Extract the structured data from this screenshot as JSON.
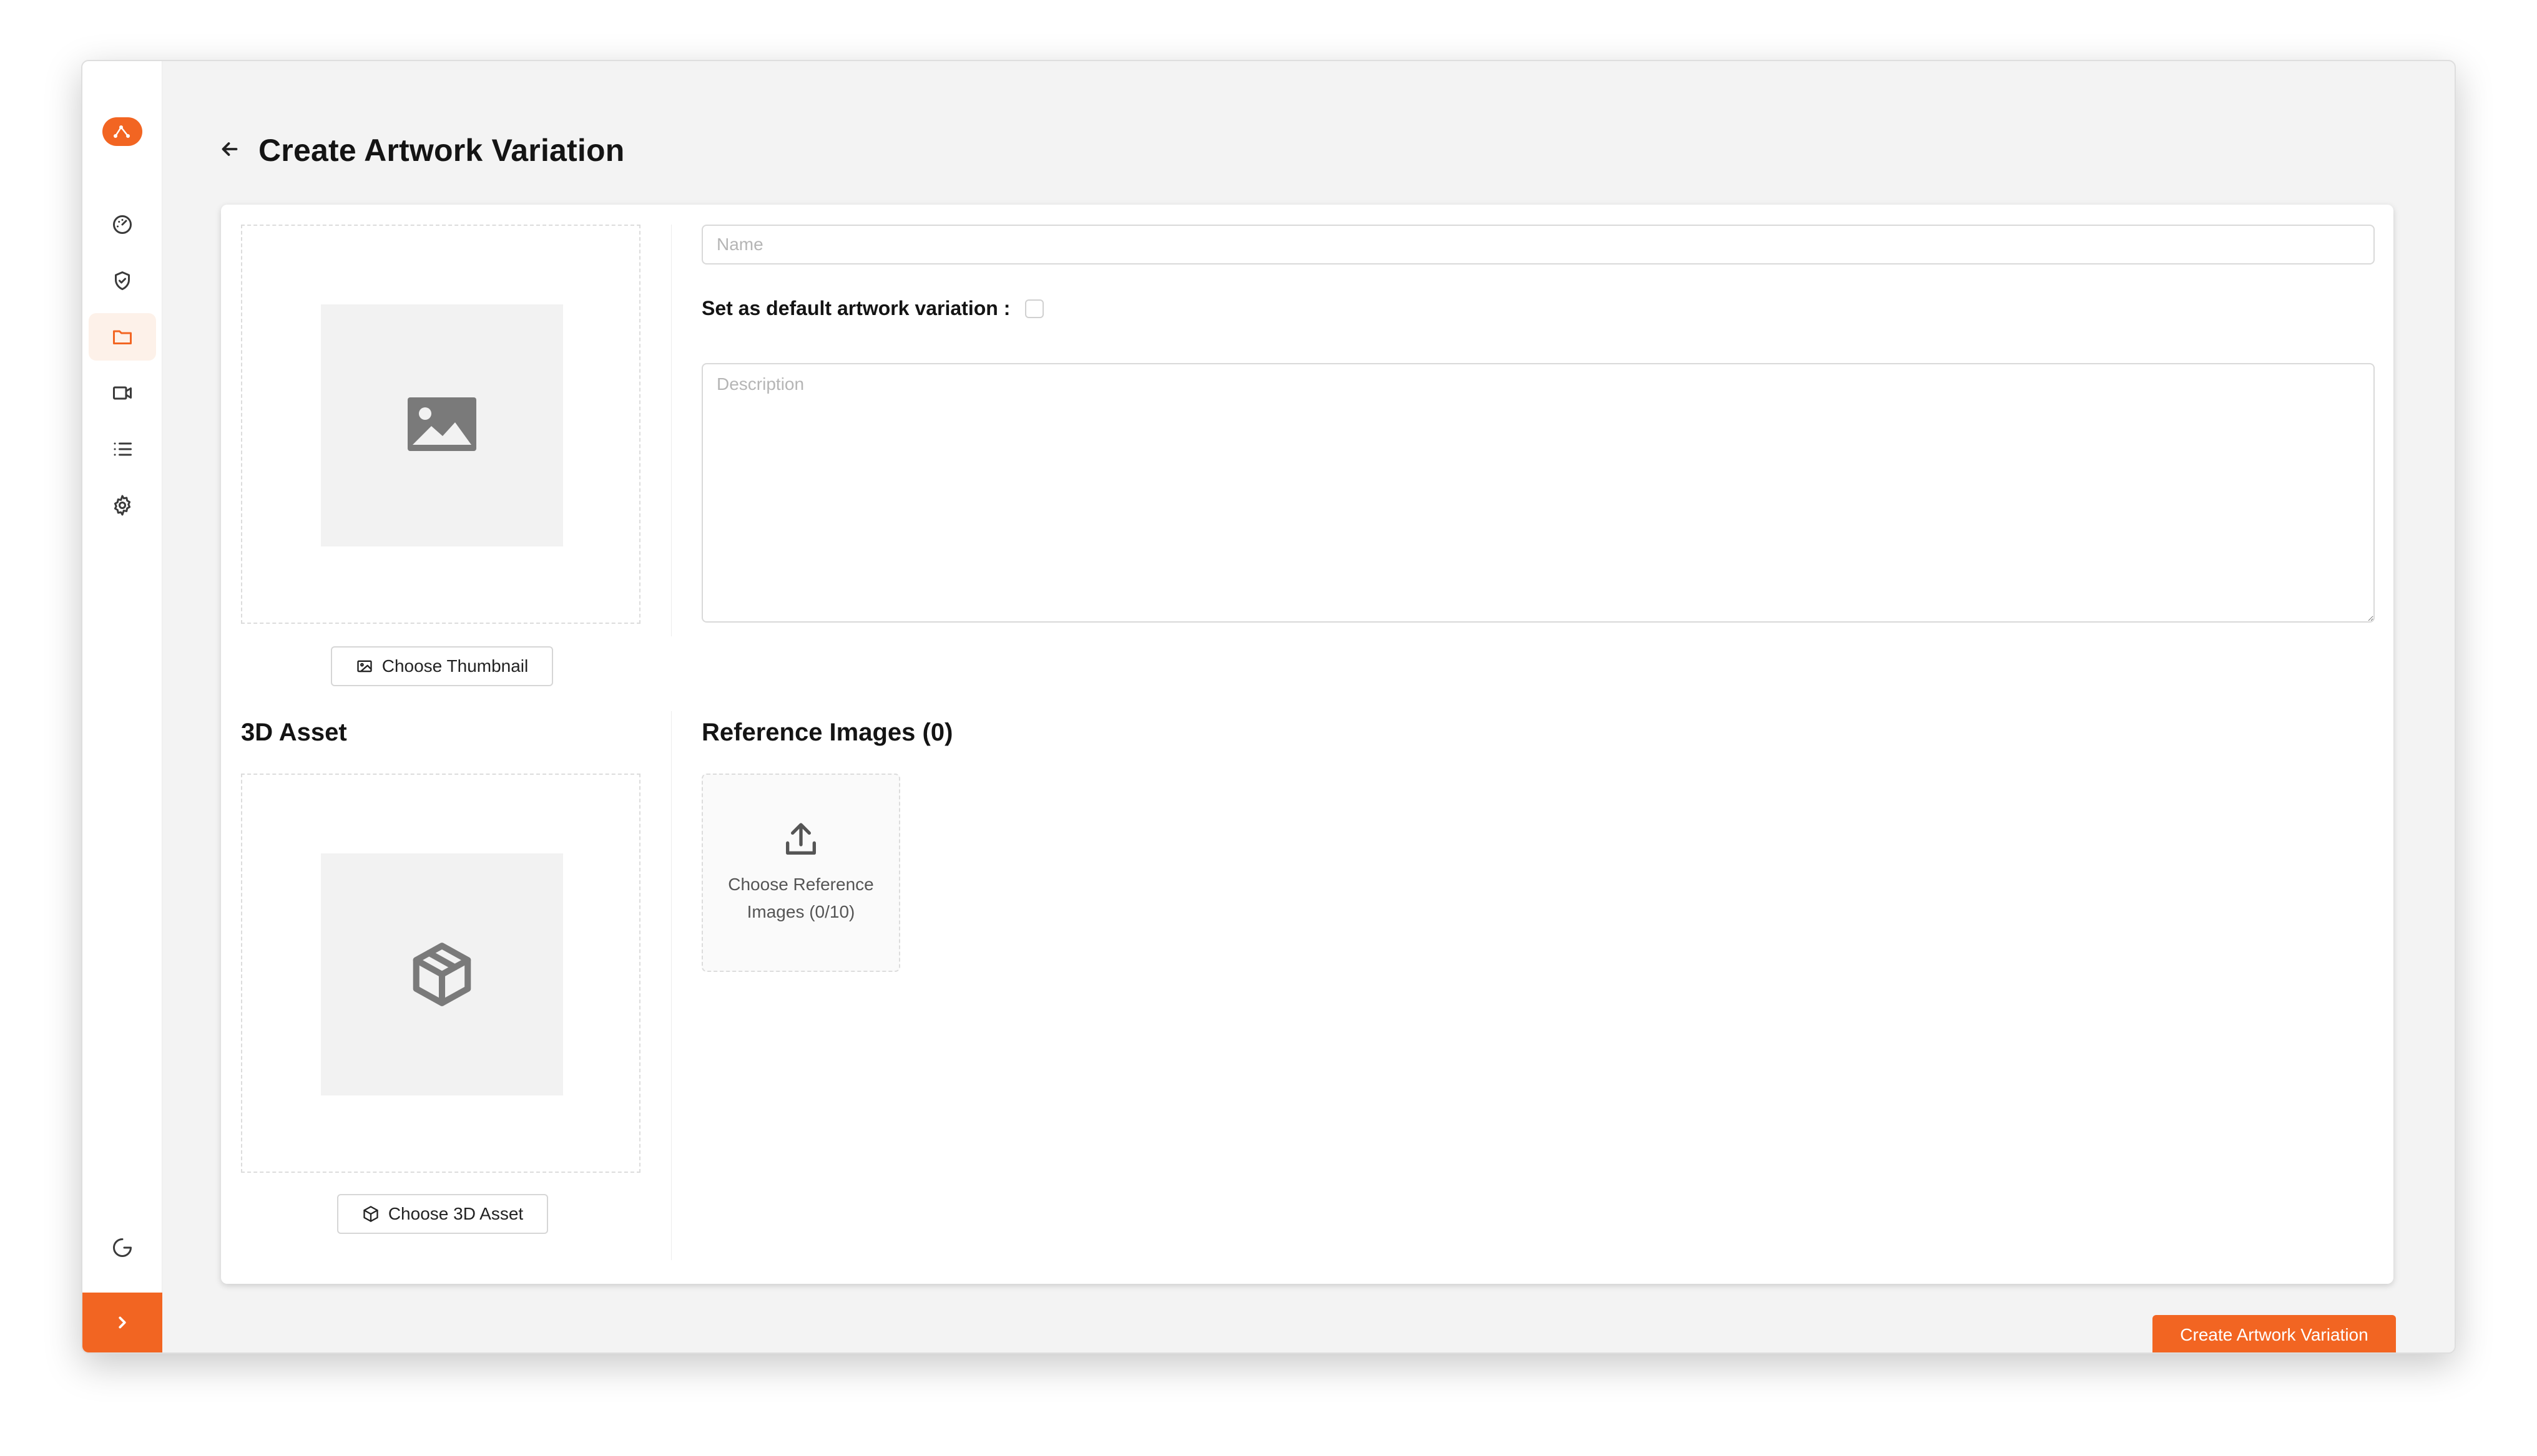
{
  "page": {
    "title": "Create Artwork Variation"
  },
  "sidebar": {
    "items": [
      {
        "name": "dashboard",
        "icon": "gauge-icon"
      },
      {
        "name": "security",
        "icon": "shield-check-icon"
      },
      {
        "name": "folders",
        "icon": "folder-icon",
        "active": true
      },
      {
        "name": "media",
        "icon": "video-icon"
      },
      {
        "name": "list",
        "icon": "list-icon"
      },
      {
        "name": "settings",
        "icon": "gear-icon"
      }
    ],
    "bottom": {
      "icon": "logout-icon"
    },
    "expand_icon": "chevron-right-icon"
  },
  "thumbnail": {
    "button_label": "Choose Thumbnail"
  },
  "asset": {
    "title": "3D Asset",
    "button_label": "Choose 3D Asset"
  },
  "form": {
    "name_placeholder": "Name",
    "default_label": "Set as default artwork variation :",
    "default_checked": false,
    "description_placeholder": "Description"
  },
  "reference": {
    "title": "Reference Images (0)",
    "upload_label": "Choose Reference Images (0/10)"
  },
  "actions": {
    "submit_label": "Create Artwork Variation"
  },
  "colors": {
    "accent": "#f26522",
    "background": "#f3f3f3",
    "card": "#ffffff"
  }
}
